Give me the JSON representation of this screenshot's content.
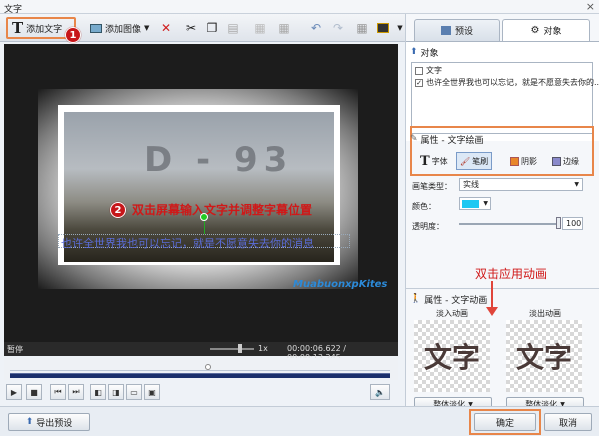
{
  "window": {
    "title": "文字",
    "close": "×"
  },
  "toolbar": {
    "add_text": "添加文字",
    "add_image": "添加图像"
  },
  "annotations": {
    "step1": "1",
    "step2": "2",
    "step2_text": "双击屏幕输入文字并调整字幕位置",
    "apply_animation": "双击应用动画"
  },
  "preview": {
    "subtitle_text": "也许全世界我也可以忘记，就是不愿意失去你的消息",
    "watermark_text": "D - 93",
    "logo": "MuabuonxpKites"
  },
  "status": {
    "state": "暂停",
    "zoom": "1x",
    "time": "00:00:06.622 / 00:00:13.245"
  },
  "progress": {
    "position_fraction": 0.52
  },
  "tabs": [
    {
      "label": "预设"
    },
    {
      "label": "对象"
    }
  ],
  "objects": {
    "header": "对象",
    "items": [
      {
        "label": "文字",
        "checked": false
      },
      {
        "label": "也许全世界我也可以忘记，就是不愿意失去你的..",
        "checked": true
      }
    ]
  },
  "attributes": {
    "header": "属性 - 文字绘画",
    "tabs": [
      {
        "label": "字体"
      },
      {
        "label": "笔刷"
      },
      {
        "label": "阴影"
      },
      {
        "label": "边缘"
      }
    ],
    "brush_type_label": "画笔类型：",
    "brush_type_value": "实线",
    "color_label": "颜色：",
    "color_value": "#1ec8f2",
    "opacity_label": "透明度：",
    "opacity_value": "100"
  },
  "animation": {
    "header": "属性 - 文字动画",
    "fade_in_label": "淡入动画",
    "fade_out_label": "淡出动画",
    "thumb_text": "文字",
    "fade_in_select": "整体淡化",
    "fade_out_select": "整体淡化"
  },
  "bottom": {
    "export_preset": "导出预设",
    "ok": "确定",
    "cancel": "取消"
  }
}
